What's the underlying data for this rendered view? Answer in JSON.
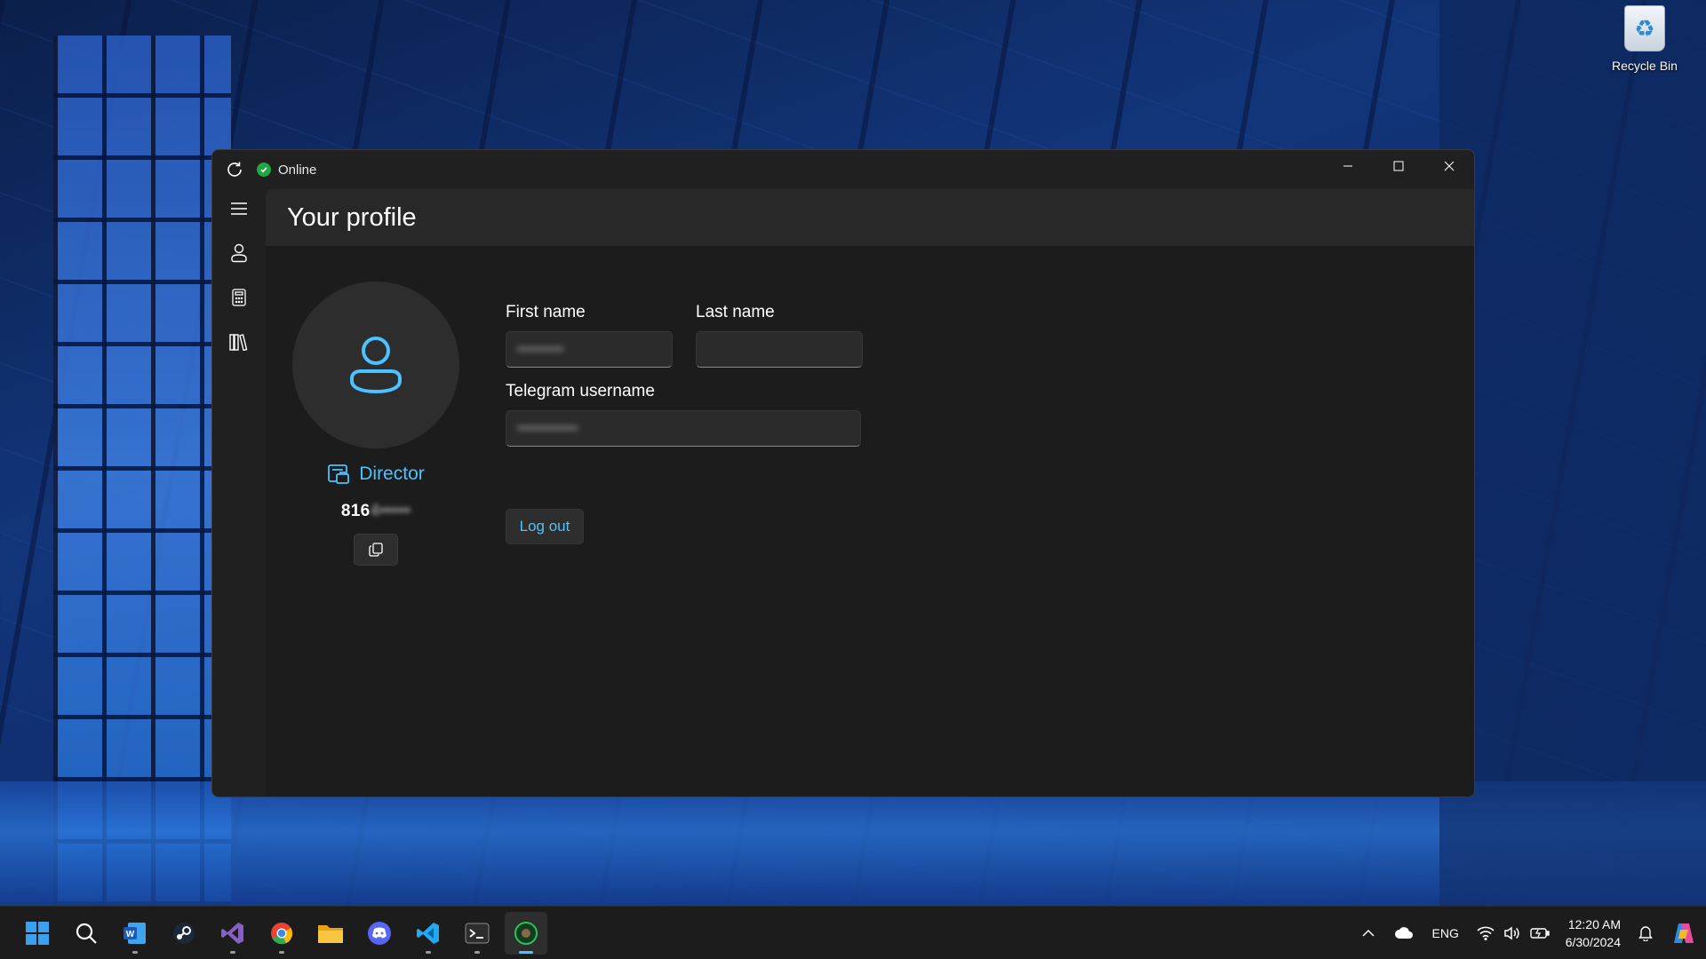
{
  "desktop": {
    "recycle_bin_label": "Recycle Bin"
  },
  "window": {
    "status_text": "Online",
    "status_color": "#22a447",
    "page_title": "Your profile",
    "nav": [
      "menu-icon",
      "profile-icon",
      "calculator-icon",
      "library-icon"
    ],
    "profile": {
      "role": "Director",
      "id_visible": "816",
      "id_hidden": "4•••••"
    },
    "form": {
      "first_name_label": "First name",
      "first_name_value": "••••••••••",
      "last_name_label": "Last name",
      "last_name_value": "",
      "telegram_label": "Telegram username",
      "telegram_value": "•••••••••••••"
    },
    "logout_label": "Log out",
    "accent": "#4cc2ff"
  },
  "taskbar": {
    "apps": [
      "windows-start-icon",
      "search-icon",
      "word-icon",
      "steam-icon",
      "visual-studio-icon",
      "chrome-icon",
      "file-explorer-icon",
      "discord-icon",
      "vscode-icon",
      "terminal-icon",
      "profile-app-icon"
    ],
    "language": "ENG",
    "time": "12:20 AM",
    "date": "6/30/2024"
  }
}
